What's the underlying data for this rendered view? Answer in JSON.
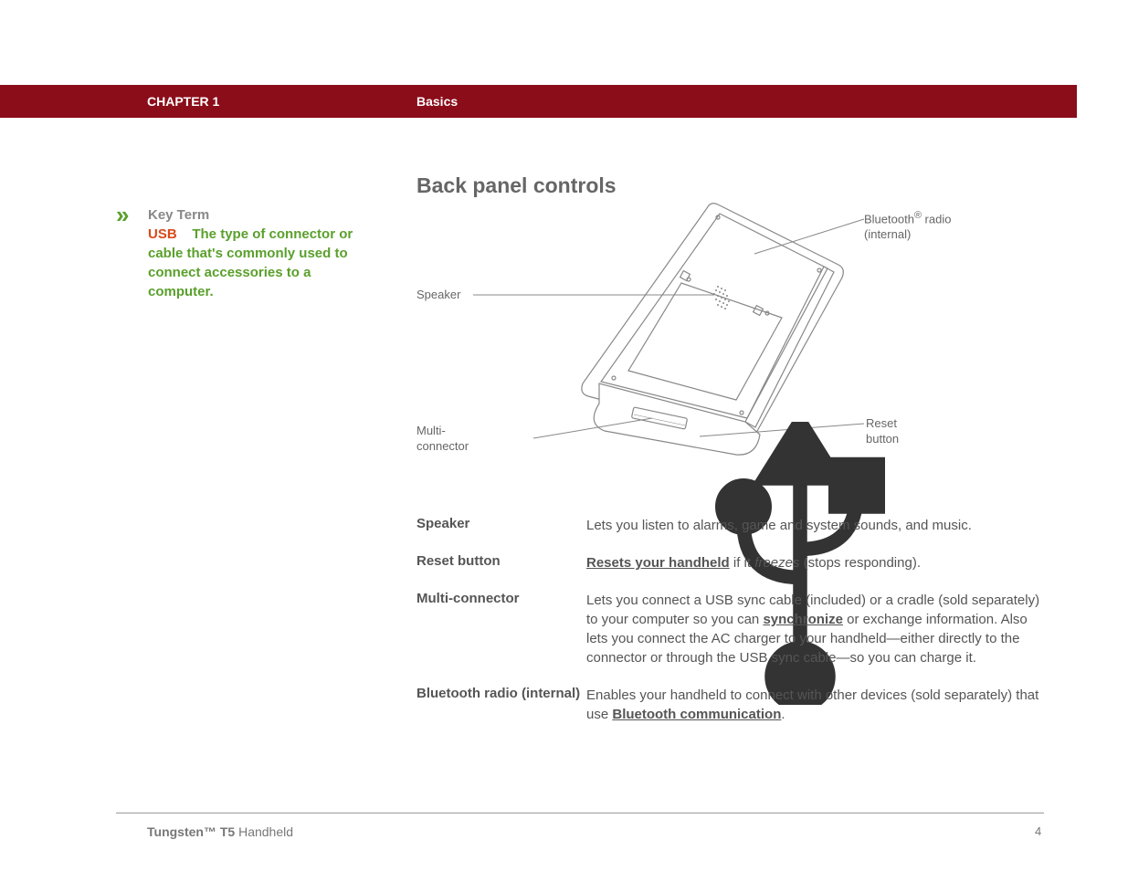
{
  "header": {
    "chapter": "CHAPTER 1",
    "section": "Basics"
  },
  "title": "Back panel controls",
  "sidebar": {
    "marker": "»",
    "label": "Key Term",
    "term": "USB",
    "definition": "The type of connector or cable that's commonly used to connect accessories to a computer."
  },
  "diagram_labels": {
    "bluetooth_line1": "Bluetooth",
    "bluetooth_sup": "®",
    "bluetooth_line1b": " radio",
    "bluetooth_line2": "(internal)",
    "speaker": "Speaker",
    "multi_line1": "Multi-",
    "multi_line2": "connector",
    "reset_line1": "Reset",
    "reset_line2": "button"
  },
  "definitions": [
    {
      "term": "Speaker",
      "parts": [
        {
          "t": "text",
          "v": "Lets you listen to alarms, game and system sounds, and music."
        }
      ]
    },
    {
      "term": "Reset button",
      "parts": [
        {
          "t": "link",
          "v": "Resets your handheld"
        },
        {
          "t": "text",
          "v": " if it "
        },
        {
          "t": "italic",
          "v": "freezes"
        },
        {
          "t": "text",
          "v": " (stops responding)."
        }
      ]
    },
    {
      "term": "Multi-connector",
      "parts": [
        {
          "t": "text",
          "v": "Lets you connect a USB sync cable (included) or a cradle (sold separately) to your computer so you can "
        },
        {
          "t": "link",
          "v": "synchronize"
        },
        {
          "t": "text",
          "v": " or exchange information. Also lets you connect the AC charger to your handheld—either directly to the connector or through the USB sync cable—so you can charge it."
        }
      ]
    },
    {
      "term": "Bluetooth radio (internal)",
      "parts": [
        {
          "t": "text",
          "v": "Enables your handheld to connect with other devices (sold separately) that use "
        },
        {
          "t": "link",
          "v": "Bluetooth communication"
        },
        {
          "t": "text",
          "v": "."
        }
      ]
    }
  ],
  "footer": {
    "product_bold": "Tungsten™ T5",
    "product_rest": " Handheld",
    "page": "4"
  }
}
